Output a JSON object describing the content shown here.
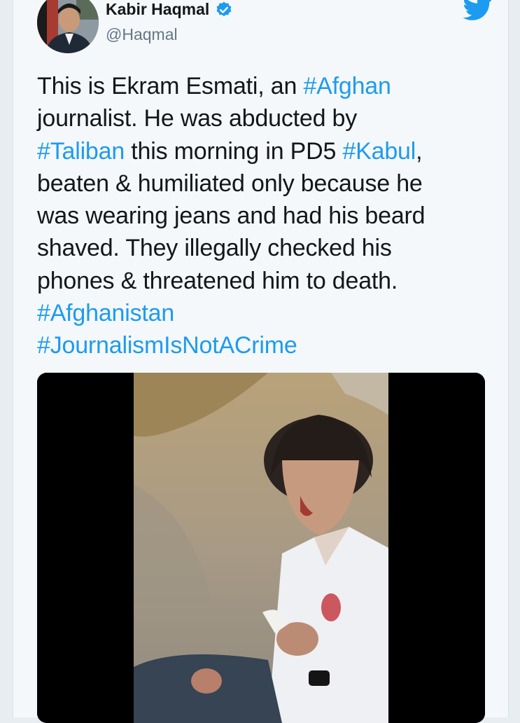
{
  "user": {
    "display_name": "Kabir Haqmal",
    "handle": "@Haqmal",
    "verified": true
  },
  "tweet": {
    "segments": [
      {
        "text": "This is Ekram Esmati, an ",
        "hashtag": false
      },
      {
        "text": "#Afghan",
        "hashtag": true
      },
      {
        "text": "\njournalist. He was abducted by\n",
        "hashtag": false
      },
      {
        "text": "#Taliban",
        "hashtag": true
      },
      {
        "text": " this morning in PD5 ",
        "hashtag": false
      },
      {
        "text": "#Kabul",
        "hashtag": true
      },
      {
        "text": ",\nbeaten & humiliated only because he\nwas wearing jeans and had his beard\nshaved. They illegally checked his\nphones & threatened him to death.\n",
        "hashtag": false
      },
      {
        "text": "#Afghanistan",
        "hashtag": true
      },
      {
        "text": "\n",
        "hashtag": false
      },
      {
        "text": "#JournalismIsNotACrime",
        "hashtag": true
      }
    ]
  },
  "colors": {
    "hashtag": "#1d9bf0",
    "verified_badge": "#1d9bf0",
    "twitter_logo": "#1d9bf0",
    "text": "#14171a",
    "muted": "#657786"
  },
  "icons": {
    "verified": "verified-badge-icon",
    "brand": "twitter-bird-icon"
  }
}
